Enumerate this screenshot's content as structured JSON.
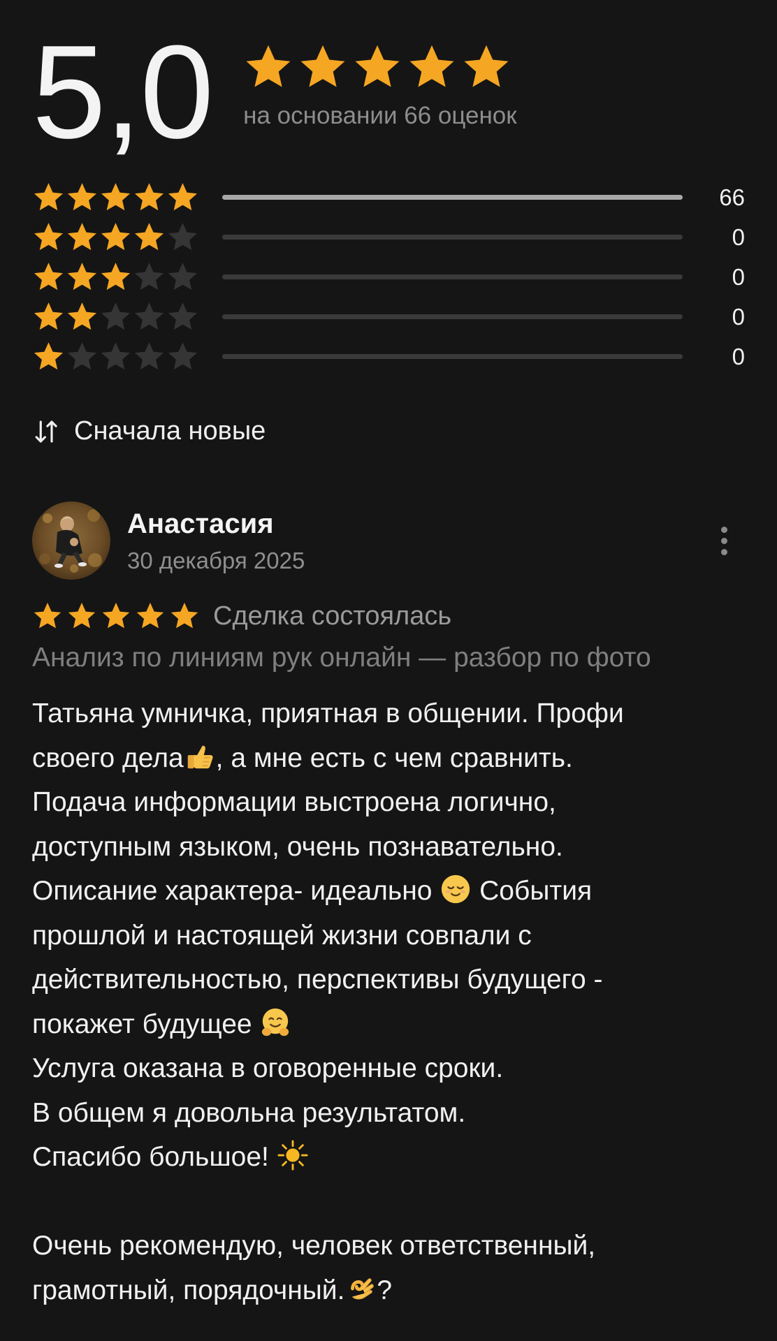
{
  "summary": {
    "average": "5,0",
    "stars_filled": 5,
    "based_on": "на основании 66 оценок"
  },
  "distribution": [
    {
      "stars": 5,
      "count": "66",
      "fraction": 1.0
    },
    {
      "stars": 4,
      "count": "0",
      "fraction": 0
    },
    {
      "stars": 3,
      "count": "0",
      "fraction": 0
    },
    {
      "stars": 2,
      "count": "0",
      "fraction": 0
    },
    {
      "stars": 1,
      "count": "0",
      "fraction": 0
    }
  ],
  "sort": {
    "icon": "sort-arrows-icon",
    "label": "Сначала новые"
  },
  "review": {
    "author": "Анастасия",
    "date": "30 декабря 2025",
    "rating": 5,
    "deal_status": "Сделка состоялась",
    "service": "Анализ по линиям рук онлайн — разбор по фото",
    "lines": [
      {
        "text": "Татьяна умничка, приятная в общении. Профи"
      },
      {
        "text": "своего дела",
        "emoji": "thumbs-up",
        "after": ", а мне есть с чем сравнить."
      },
      {
        "text": "Подача информации выстроена логично,"
      },
      {
        "text": "доступным языком, очень познавательно."
      },
      {
        "text": "Описание характера- идеально ",
        "emoji": "relieved-face",
        "after": " События"
      },
      {
        "text": "прошлой и настоящей жизни совпали с"
      },
      {
        "text": "действительностью, перспективы будущего -"
      },
      {
        "text": "покажет будущее ",
        "emoji": "hugging-face",
        "after": ""
      },
      {
        "text": "Услуга оказана в оговоренные сроки."
      },
      {
        "text": "В общем я довольна результатом."
      },
      {
        "text": "Спасибо большое! ",
        "emoji": "sun",
        "after": ""
      },
      {
        "text": ""
      },
      {
        "text": "Очень рекомендую, человек ответственный,"
      },
      {
        "text": "грамотный, порядочный.",
        "emoji": "ok-hand",
        "after": "?"
      }
    ]
  },
  "colors": {
    "background": "#151515",
    "star_gold": "#f5a623",
    "star_empty": "#353535",
    "bar_fill": "#a8a8a8",
    "bar_track": "#3a3a3a"
  }
}
